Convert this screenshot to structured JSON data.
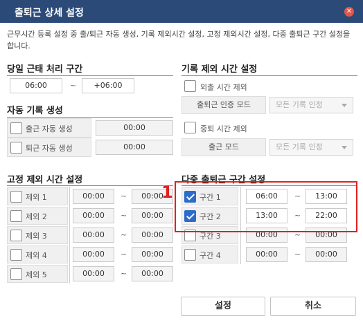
{
  "window": {
    "title": "출퇴근 상세 설정",
    "close_glyph": "✕"
  },
  "description": "근무시간 등록 설정 중 출/퇴근 자동 생성, 기록 제외시간 설정, 고정 제외시간 설정, 다중 출퇴근 구간 설정을 합니다.",
  "day_range": {
    "title": "당일 근태 처리 구간",
    "start": "06:00",
    "tilde": "~",
    "end": "+06:00"
  },
  "auto_record": {
    "title": "자동 기록 생성",
    "items": [
      {
        "label": "출근 자동 생성",
        "time": "00:00",
        "checked": false
      },
      {
        "label": "퇴근 자동 생성",
        "time": "00:00",
        "checked": false
      }
    ]
  },
  "record_exclude": {
    "title": "기록 제외 시간 설정",
    "outing": {
      "label": "외출 시간 제외",
      "checked": false
    },
    "auth_mode": {
      "label": "출퇴근 인증 모드",
      "value": "모든 기록 인정"
    },
    "mid_leave": {
      "label": "중퇴 시간 제외",
      "checked": false
    },
    "clock_in_mode": {
      "label": "출근 모드",
      "value": "모든 기록 인정"
    }
  },
  "fixed_exclude": {
    "title": "고정 제외 시간 설정",
    "rows": [
      {
        "label": "제외 1",
        "start": "00:00",
        "end": "00:00",
        "checked": false
      },
      {
        "label": "제외 2",
        "start": "00:00",
        "end": "00:00",
        "checked": false
      },
      {
        "label": "제외 3",
        "start": "00:00",
        "end": "00:00",
        "checked": false
      },
      {
        "label": "제외 4",
        "start": "00:00",
        "end": "00:00",
        "checked": false
      },
      {
        "label": "제외 5",
        "start": "00:00",
        "end": "00:00",
        "checked": false
      }
    ]
  },
  "multi_range": {
    "title": "다중 출퇴근 구간 설정",
    "rows": [
      {
        "label": "구간 1",
        "start": "06:00",
        "end": "13:00",
        "checked": true
      },
      {
        "label": "구간 2",
        "start": "13:00",
        "end": "22:00",
        "checked": true
      },
      {
        "label": "구간 3",
        "start": "00:00",
        "end": "00:00",
        "checked": false
      },
      {
        "label": "구간 4",
        "start": "00:00",
        "end": "00:00",
        "checked": false
      }
    ]
  },
  "annotation": {
    "marker": "1",
    "color": "#e02020"
  },
  "buttons": {
    "save": "설정",
    "cancel": "취소"
  },
  "colors": {
    "titlebar": "#2b4a78",
    "checkbox_checked": "#2d6cc8",
    "close": "#e2574c"
  }
}
